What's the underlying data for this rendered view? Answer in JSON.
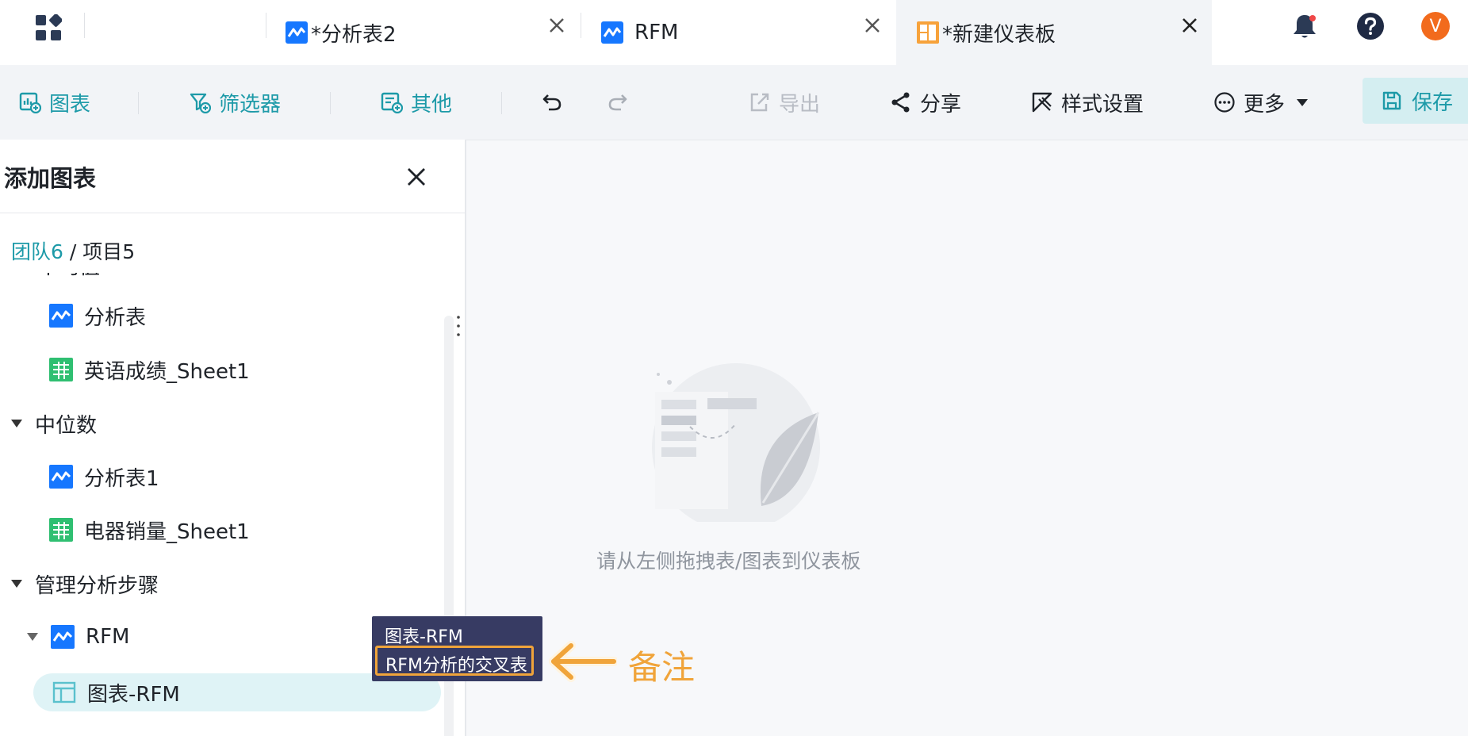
{
  "tabs": [
    {
      "label": "*分析表2",
      "icon": "analysis-table-icon"
    },
    {
      "label": "RFM",
      "icon": "analysis-table-icon"
    },
    {
      "label": "*新建仪表板",
      "icon": "dashboard-icon"
    }
  ],
  "header_icons": {
    "bell": "notification-bell-icon",
    "help": "help-icon",
    "avatar_letter": "V"
  },
  "toolbar": {
    "chart": "图表",
    "filter": "筛选器",
    "other": "其他",
    "export": "导出",
    "share": "分享",
    "style": "样式设置",
    "more": "更多",
    "save": "保存"
  },
  "panel": {
    "title": "添加图表",
    "breadcrumb": {
      "team": "团队6",
      "sep": "/",
      "project": "项目5"
    },
    "partial_heading": "平均值",
    "tree": [
      {
        "label": "分析表",
        "type": "analysis",
        "level": 2
      },
      {
        "label": "英语成绩_Sheet1",
        "type": "sheet",
        "level": 2
      },
      {
        "label": "中位数",
        "type": "folder",
        "level": 1
      },
      {
        "label": "分析表1",
        "type": "analysis",
        "level": 2
      },
      {
        "label": "电器销量_Sheet1",
        "type": "sheet",
        "level": 2
      },
      {
        "label": "管理分析步骤",
        "type": "folder",
        "level": 1
      },
      {
        "label": "RFM",
        "type": "analysis-expanded",
        "level": 2
      },
      {
        "label": "图表-RFM",
        "type": "chart",
        "level": 3,
        "selected": true
      }
    ]
  },
  "canvas": {
    "empty_text": "请从左侧拖拽表/图表到仪表板"
  },
  "tooltip": {
    "title": "图表-RFM",
    "note": "RFM分析的交叉表"
  },
  "annotation": {
    "label": "备注",
    "color": "#f0a43a"
  },
  "colors": {
    "accent": "#1d9aa8",
    "brand_blue": "#1677ff",
    "sheet_green": "#2fbf71",
    "dashboard_orange": "#f7a23b"
  }
}
